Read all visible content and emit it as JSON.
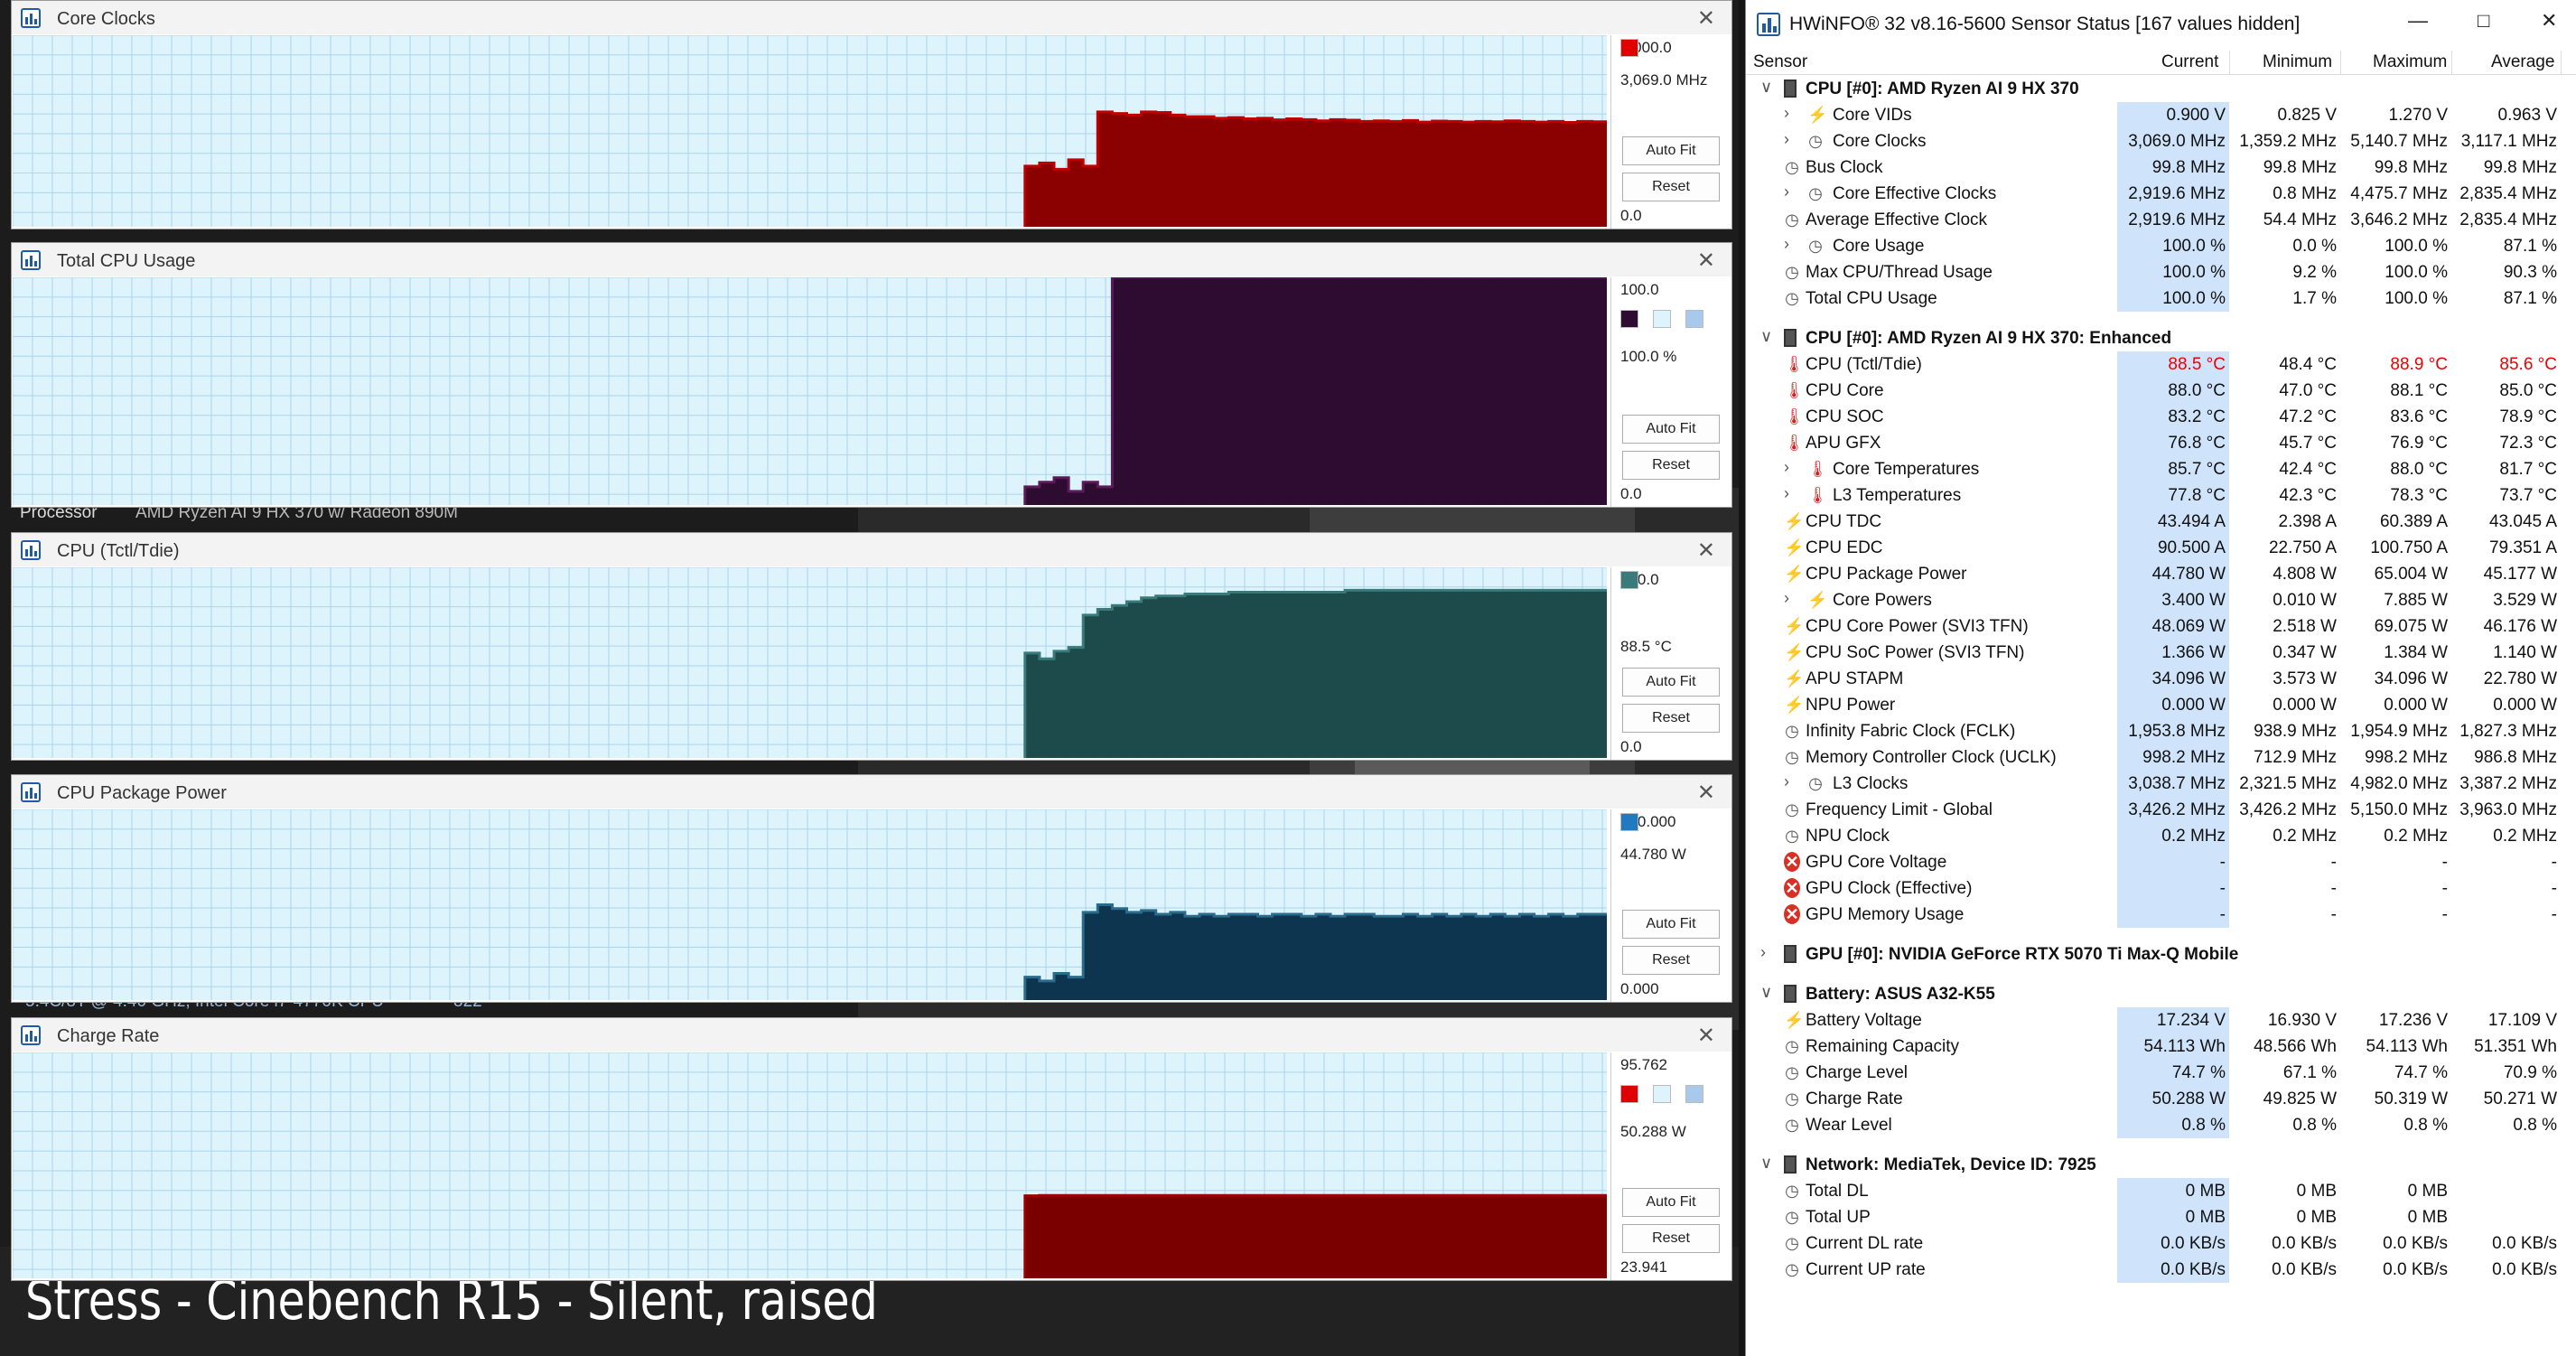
{
  "caption": "Stress - Cinebench R15 - Silent, raised",
  "background": {
    "processor_label": "Processor",
    "processor_value": "AMD Ryzen AI 9 HX 370 w/ Radeon 890M",
    "bench_line": "5.4C/8T @ 4.40 GHz, Intel Core i7-4770K CPU",
    "bench_score": "822"
  },
  "graphs": [
    {
      "title": "Core Clocks",
      "top_value": "6,000.0",
      "current": "3,069.0 MHz",
      "bottom": "0.0",
      "color": "#c00000",
      "fill": "#8b0000",
      "chart_data": {
        "type": "area",
        "start": 0.635,
        "ymax": 6000,
        "values": [
          1900,
          2000,
          1800,
          2100,
          1900,
          3600,
          3550,
          3500,
          3600,
          3580,
          3500,
          3450,
          3450,
          3400,
          3420,
          3380,
          3400,
          3350,
          3380,
          3360,
          3320,
          3360,
          3340,
          3300,
          3320,
          3300,
          3330,
          3280,
          3310,
          3300,
          3280,
          3300,
          3290,
          3320,
          3300,
          3280,
          3300,
          3270,
          3300,
          3290
        ]
      },
      "swatches": [
        "#e00000"
      ]
    },
    {
      "title": "Total CPU Usage",
      "top_value": "100.0",
      "current": "100.0 %",
      "bottom": "0.0",
      "color": "#5a1a5a",
      "fill": "#2e0b30",
      "chart_data": {
        "type": "area",
        "start": 0.635,
        "ymax": 100,
        "values": [
          8,
          10,
          12,
          6,
          10,
          8,
          100,
          100,
          100,
          100,
          100,
          100,
          100,
          100,
          100,
          100,
          100,
          100,
          100,
          100,
          100,
          100,
          100,
          100,
          100,
          100,
          100,
          100,
          100,
          100,
          100,
          100,
          100,
          100,
          100,
          100,
          100,
          100,
          100,
          100
        ]
      },
      "swatches": [
        "#2e0b30",
        "#ddf4fc",
        "#a8c8ec"
      ]
    },
    {
      "title": "CPU (Tctl/Tdie)",
      "top_value": "100.0",
      "current": "88.5 °C",
      "bottom": "0.0",
      "color": "#3a7a7a",
      "fill": "#1d4a4a",
      "chart_data": {
        "type": "area",
        "start": 0.635,
        "ymax": 100,
        "values": [
          55,
          52,
          56,
          58,
          75,
          78,
          80,
          82,
          84,
          85,
          85,
          86,
          86,
          86,
          87,
          87,
          87,
          87,
          87,
          87,
          87,
          87,
          88,
          88,
          88,
          88,
          88,
          88,
          88,
          88,
          88,
          88,
          88,
          88,
          88,
          88,
          88,
          88,
          88,
          88
        ]
      },
      "swatches": [
        "#3a7a7a"
      ]
    },
    {
      "title": "CPU Package Power",
      "top_value": "100.000",
      "current": "44.780 W",
      "bottom": "0.000",
      "color": "#2a6a8a",
      "fill": "#0d3550",
      "chart_data": {
        "type": "area",
        "start": 0.635,
        "ymax": 100,
        "values": [
          12,
          10,
          14,
          12,
          46,
          50,
          48,
          46,
          47,
          45,
          46,
          44,
          45,
          44,
          45,
          45,
          44,
          45,
          45,
          44,
          45,
          44,
          45,
          45,
          44,
          44,
          45,
          44,
          45,
          44,
          45,
          44,
          45,
          44,
          45,
          44,
          45,
          44,
          45,
          45
        ]
      },
      "swatches": [
        "#1f7ac2"
      ]
    },
    {
      "title": "Charge Rate",
      "top_value": "95.762",
      "current": "50.288 W",
      "bottom": "23.941",
      "color": "#a00000",
      "fill": "#7a0000",
      "chart_data": {
        "type": "area",
        "start": 0.635,
        "ymax": 95.762,
        "ymin": 23.941,
        "values": [
          50.2,
          50.3,
          50.3,
          50.3,
          50.3,
          50.3,
          50.3,
          50.3,
          50.3,
          50.3,
          50.3,
          50.3,
          50.3,
          50.3,
          50.3,
          50.3,
          50.3,
          50.3,
          50.3,
          50.3,
          50.3,
          50.3,
          50.3,
          50.3,
          50.3,
          50.3,
          50.3,
          50.3,
          50.3,
          50.3,
          50.3,
          50.3,
          50.3,
          50.3,
          50.3,
          50.3,
          50.3,
          50.3,
          50.3,
          50.3
        ]
      },
      "swatches": [
        "#e00000",
        "#ddf4fc",
        "#a8c8ec"
      ]
    }
  ],
  "buttons": {
    "auto_fit": "Auto Fit",
    "reset": "Reset"
  },
  "hwinfo": {
    "title": "HWiNFO® 32 v8.16-5600 Sensor Status [167 values hidden]",
    "columns": [
      "Sensor",
      "Current",
      "Minimum",
      "Maximum",
      "Average"
    ],
    "rows": [
      {
        "type": "group",
        "label": "CPU [#0]: AMD Ryzen AI 9 HX 370",
        "open": true
      },
      {
        "label": "Core VIDs",
        "icon": "bolt",
        "sub": true,
        "cur": "0.900 V",
        "min": "0.825 V",
        "max": "1.270 V",
        "avg": "0.963 V"
      },
      {
        "label": "Core Clocks",
        "icon": "clock",
        "sub": true,
        "cur": "3,069.0 MHz",
        "min": "1,359.2 MHz",
        "max": "5,140.7 MHz",
        "avg": "3,117.1 MHz"
      },
      {
        "label": "Bus Clock",
        "icon": "clock",
        "cur": "99.8 MHz",
        "min": "99.8 MHz",
        "max": "99.8 MHz",
        "avg": "99.8 MHz"
      },
      {
        "label": "Core Effective Clocks",
        "icon": "clock",
        "sub": true,
        "cur": "2,919.6 MHz",
        "min": "0.8 MHz",
        "max": "4,475.7 MHz",
        "avg": "2,835.4 MHz"
      },
      {
        "label": "Average Effective Clock",
        "icon": "clock",
        "cur": "2,919.6 MHz",
        "min": "54.4 MHz",
        "max": "3,646.2 MHz",
        "avg": "2,835.4 MHz"
      },
      {
        "label": "Core Usage",
        "icon": "clock",
        "sub": true,
        "cur": "100.0 %",
        "min": "0.0 %",
        "max": "100.0 %",
        "avg": "87.1 %"
      },
      {
        "label": "Max CPU/Thread Usage",
        "icon": "clock",
        "cur": "100.0 %",
        "min": "9.2 %",
        "max": "100.0 %",
        "avg": "90.3 %"
      },
      {
        "label": "Total CPU Usage",
        "icon": "clock",
        "cur": "100.0 %",
        "min": "1.7 %",
        "max": "100.0 %",
        "avg": "87.1 %"
      },
      {
        "type": "gap"
      },
      {
        "type": "group",
        "label": "CPU [#0]: AMD Ryzen AI 9 HX 370: Enhanced",
        "open": true
      },
      {
        "label": "CPU (Tctl/Tdie)",
        "icon": "therm",
        "cur": "88.5 °C",
        "min": "48.4 °C",
        "max": "88.9 °C",
        "avg": "85.6 °C",
        "red": true
      },
      {
        "label": "CPU Core",
        "icon": "therm",
        "cur": "88.0 °C",
        "min": "47.0 °C",
        "max": "88.1 °C",
        "avg": "85.0 °C"
      },
      {
        "label": "CPU SOC",
        "icon": "therm",
        "cur": "83.2 °C",
        "min": "47.2 °C",
        "max": "83.6 °C",
        "avg": "78.9 °C"
      },
      {
        "label": "APU GFX",
        "icon": "therm",
        "cur": "76.8 °C",
        "min": "45.7 °C",
        "max": "76.9 °C",
        "avg": "72.3 °C"
      },
      {
        "label": "Core Temperatures",
        "icon": "therm",
        "sub": true,
        "cur": "85.7 °C",
        "min": "42.4 °C",
        "max": "88.0 °C",
        "avg": "81.7 °C"
      },
      {
        "label": "L3 Temperatures",
        "icon": "therm",
        "sub": true,
        "cur": "77.8 °C",
        "min": "42.3 °C",
        "max": "78.3 °C",
        "avg": "73.7 °C"
      },
      {
        "label": "CPU TDC",
        "icon": "bolt",
        "cur": "43.494 A",
        "min": "2.398 A",
        "max": "60.389 A",
        "avg": "43.045 A"
      },
      {
        "label": "CPU EDC",
        "icon": "bolt",
        "cur": "90.500 A",
        "min": "22.750 A",
        "max": "100.750 A",
        "avg": "79.351 A"
      },
      {
        "label": "CPU Package Power",
        "icon": "bolt",
        "cur": "44.780 W",
        "min": "4.808 W",
        "max": "65.004 W",
        "avg": "45.177 W"
      },
      {
        "label": "Core Powers",
        "icon": "bolt",
        "sub": true,
        "cur": "3.400 W",
        "min": "0.010 W",
        "max": "7.885 W",
        "avg": "3.529 W"
      },
      {
        "label": "CPU Core Power (SVI3 TFN)",
        "icon": "bolt",
        "cur": "48.069 W",
        "min": "2.518 W",
        "max": "69.075 W",
        "avg": "46.176 W"
      },
      {
        "label": "CPU SoC Power (SVI3 TFN)",
        "icon": "bolt",
        "cur": "1.366 W",
        "min": "0.347 W",
        "max": "1.384 W",
        "avg": "1.140 W"
      },
      {
        "label": "APU STAPM",
        "icon": "bolt",
        "cur": "34.096 W",
        "min": "3.573 W",
        "max": "34.096 W",
        "avg": "22.780 W"
      },
      {
        "label": "NPU Power",
        "icon": "bolt",
        "cur": "0.000 W",
        "min": "0.000 W",
        "max": "0.000 W",
        "avg": "0.000 W"
      },
      {
        "label": "Infinity Fabric Clock (FCLK)",
        "icon": "clock",
        "cur": "1,953.8 MHz",
        "min": "938.9 MHz",
        "max": "1,954.9 MHz",
        "avg": "1,827.3 MHz"
      },
      {
        "label": "Memory Controller Clock (UCLK)",
        "icon": "clock",
        "cur": "998.2 MHz",
        "min": "712.9 MHz",
        "max": "998.2 MHz",
        "avg": "986.8 MHz"
      },
      {
        "label": "L3 Clocks",
        "icon": "clock",
        "sub": true,
        "cur": "3,038.7 MHz",
        "min": "2,321.5 MHz",
        "max": "4,982.0 MHz",
        "avg": "3,387.2 MHz"
      },
      {
        "label": "Frequency Limit - Global",
        "icon": "clock",
        "cur": "3,426.2 MHz",
        "min": "3,426.2 MHz",
        "max": "5,150.0 MHz",
        "avg": "3,963.0 MHz"
      },
      {
        "label": "NPU Clock",
        "icon": "clock",
        "cur": "0.2 MHz",
        "min": "0.2 MHz",
        "max": "0.2 MHz",
        "avg": "0.2 MHz"
      },
      {
        "label": "GPU Core Voltage",
        "icon": "err",
        "cur": "-",
        "min": "-",
        "max": "-",
        "avg": "-"
      },
      {
        "label": "GPU Clock (Effective)",
        "icon": "err",
        "cur": "-",
        "min": "-",
        "max": "-",
        "avg": "-"
      },
      {
        "label": "GPU Memory Usage",
        "icon": "err",
        "cur": "-",
        "min": "-",
        "max": "-",
        "avg": "-"
      },
      {
        "type": "gap"
      },
      {
        "type": "group",
        "label": "GPU [#0]: NVIDIA  GeForce RTX 5070 Ti Max-Q Mobile",
        "open": false
      },
      {
        "type": "gap"
      },
      {
        "type": "group",
        "label": "Battery: ASUS  A32-K55",
        "open": true
      },
      {
        "label": "Battery Voltage",
        "icon": "bolt",
        "cur": "17.234 V",
        "min": "16.930 V",
        "max": "17.236 V",
        "avg": "17.109 V"
      },
      {
        "label": "Remaining Capacity",
        "icon": "clock",
        "cur": "54.113 Wh",
        "min": "48.566 Wh",
        "max": "54.113 Wh",
        "avg": "51.351 Wh"
      },
      {
        "label": "Charge Level",
        "icon": "clock",
        "cur": "74.7 %",
        "min": "67.1 %",
        "max": "74.7 %",
        "avg": "70.9 %"
      },
      {
        "label": "Charge Rate",
        "icon": "clock",
        "cur": "50.288 W",
        "min": "49.825 W",
        "max": "50.319 W",
        "avg": "50.271 W"
      },
      {
        "label": "Wear Level",
        "icon": "clock",
        "cur": "0.8 %",
        "min": "0.8 %",
        "max": "0.8 %",
        "avg": "0.8 %"
      },
      {
        "type": "gap"
      },
      {
        "type": "group",
        "label": "Network: MediaTek, Device ID: 7925",
        "open": true
      },
      {
        "label": "Total DL",
        "icon": "clock",
        "cur": "0 MB",
        "min": "0 MB",
        "max": "0 MB",
        "avg": ""
      },
      {
        "label": "Total UP",
        "icon": "clock",
        "cur": "0 MB",
        "min": "0 MB",
        "max": "0 MB",
        "avg": ""
      },
      {
        "label": "Current DL rate",
        "icon": "clock",
        "cur": "0.0 KB/s",
        "min": "0.0 KB/s",
        "max": "0.0 KB/s",
        "avg": "0.0 KB/s"
      },
      {
        "label": "Current UP rate",
        "icon": "clock",
        "cur": "0.0 KB/s",
        "min": "0.0 KB/s",
        "max": "0.0 KB/s",
        "avg": "0.0 KB/s"
      }
    ]
  }
}
